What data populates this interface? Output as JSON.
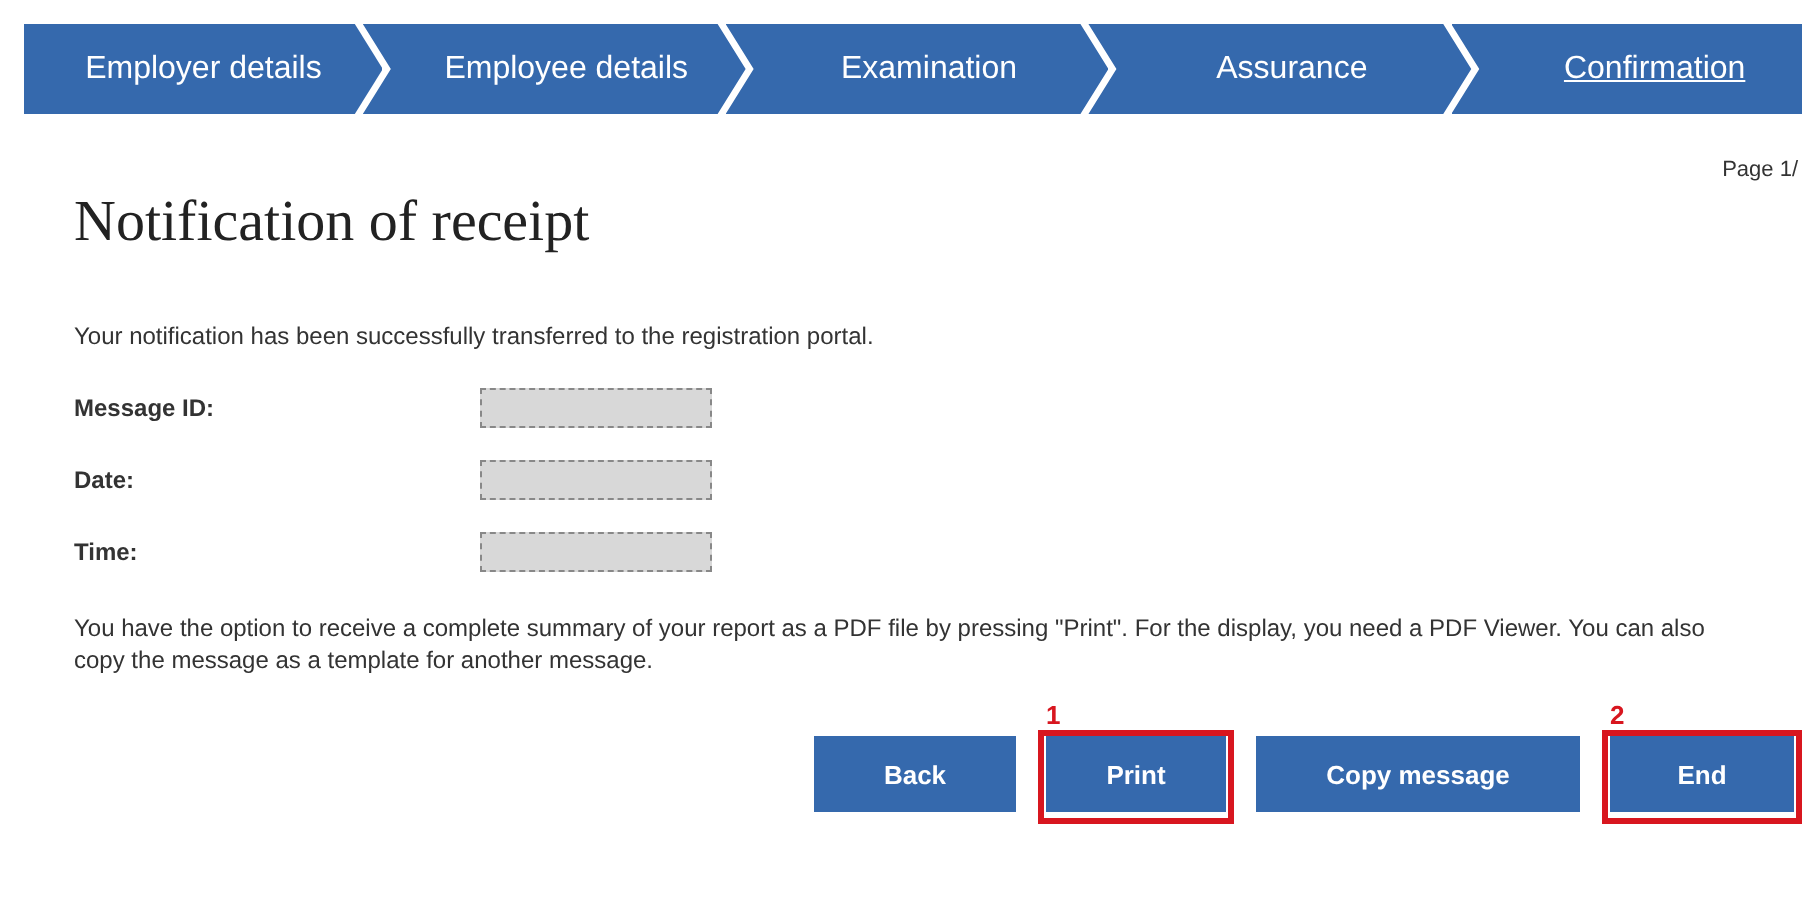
{
  "steps": [
    {
      "label": "Employer details",
      "selected": false
    },
    {
      "label": "Employee details",
      "selected": false
    },
    {
      "label": "Examination",
      "selected": false
    },
    {
      "label": "Assurance",
      "selected": false
    },
    {
      "label": "Confirmation",
      "selected": true
    }
  ],
  "page_number": "Page 1/",
  "title": "Notification of receipt",
  "intro": "Your notification has been successfully transferred to the registration portal.",
  "fields": [
    {
      "label": "Message ID:"
    },
    {
      "label": "Date:"
    },
    {
      "label": "Time:"
    }
  ],
  "note": "You have the option to receive a complete summary of your report as a PDF file by pressing \"Print\". For the display, you need a PDF Viewer. You can also copy the message as a template for another message.",
  "buttons": [
    {
      "label": "Back"
    },
    {
      "label": "Print",
      "marker": "1"
    },
    {
      "label": "Copy message"
    },
    {
      "label": "End",
      "marker": "2"
    }
  ]
}
